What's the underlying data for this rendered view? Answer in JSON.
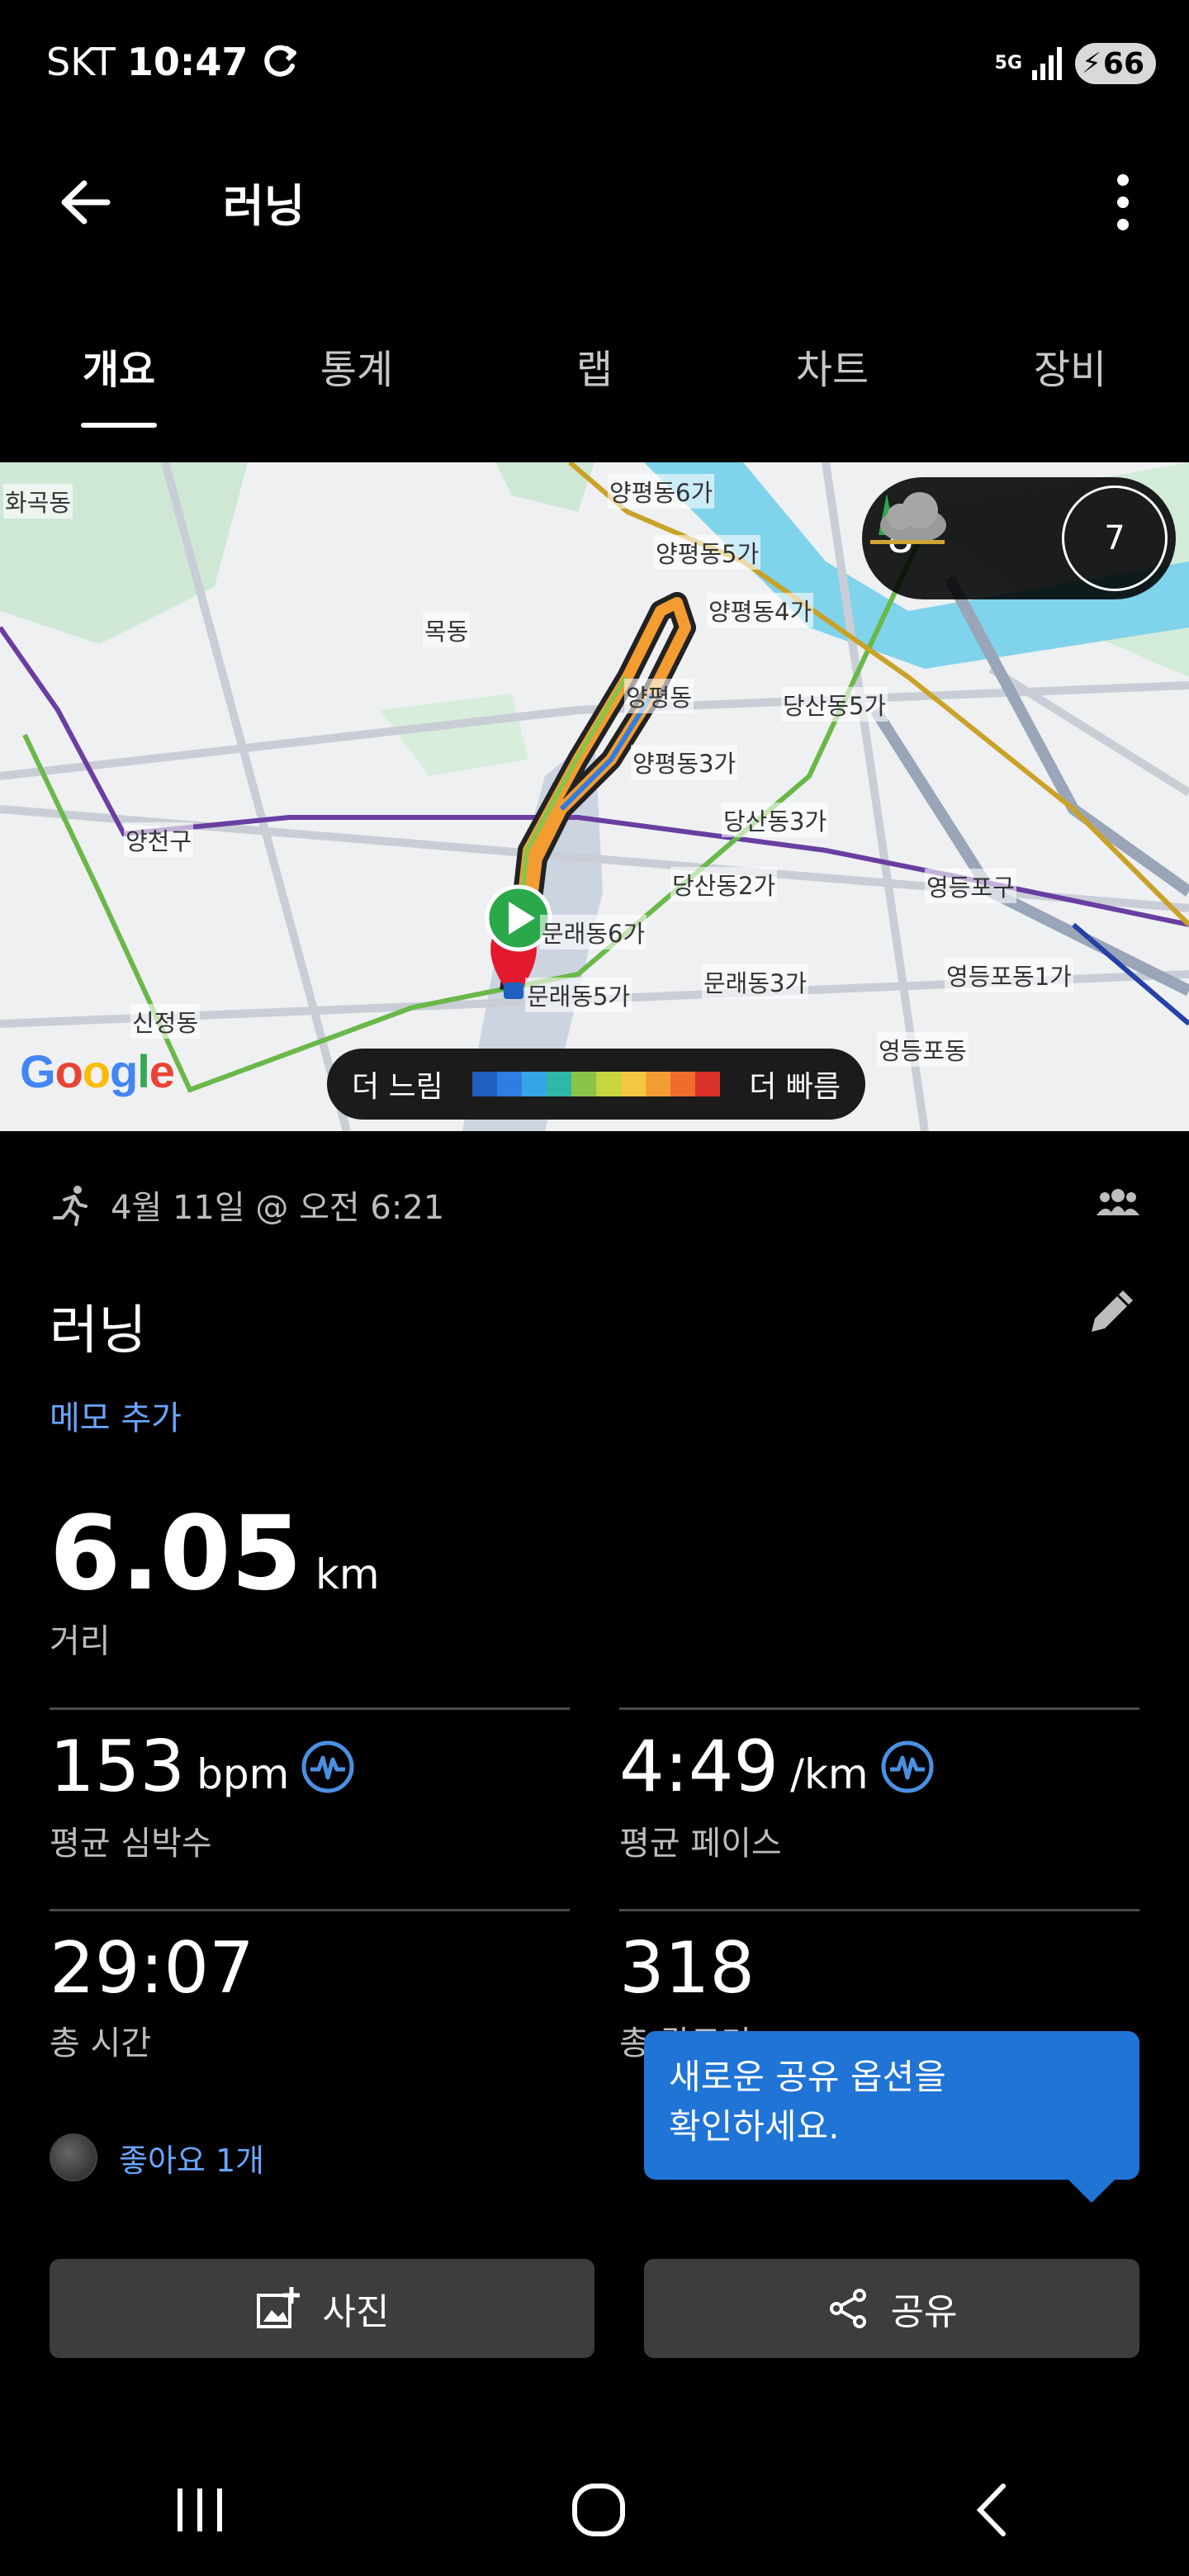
{
  "status_bar": {
    "carrier": "SKT",
    "time": "10:47",
    "network": "5G",
    "battery": "66"
  },
  "app_bar": {
    "title": "러닝"
  },
  "tabs": [
    {
      "label": "개요",
      "active": true
    },
    {
      "label": "통계",
      "active": false
    },
    {
      "label": "랩",
      "active": false
    },
    {
      "label": "차트",
      "active": false
    },
    {
      "label": "장비",
      "active": false
    }
  ],
  "map": {
    "labels": [
      "화곡동",
      "양평동6가",
      "양평동5가",
      "목동",
      "양평동4가",
      "양평동",
      "당산동5가",
      "양평동3가",
      "당산동3가",
      "양천구",
      "당산동2가",
      "영등포구",
      "문래동6가",
      "문래동5가",
      "문래동3가",
      "영등포동1가",
      "신정동",
      "영등포동"
    ],
    "google_logo": "Google",
    "weather": {
      "temperature": "8°",
      "icon": "cloudy-night-icon"
    },
    "compass_value": "7",
    "pace_legend": {
      "slow_label": "더 느림",
      "fast_label": "더 빠름",
      "colors": [
        "#1e5fbf",
        "#2f7de0",
        "#35a5e8",
        "#2fb7a8",
        "#8bc34a",
        "#c6d640",
        "#f2c744",
        "#f39c32",
        "#ef6c2c",
        "#d8312a"
      ]
    }
  },
  "activity": {
    "date_time": "4월 11일 @ 오전 6:21",
    "title": "러닝",
    "memo_link": "메모 추가"
  },
  "distance": {
    "value": "6.05",
    "unit": "km",
    "label": "거리"
  },
  "stats": {
    "heart_rate": {
      "value": "153",
      "unit": "bpm",
      "label": "평균 심박수"
    },
    "pace": {
      "value": "4:49",
      "unit": "/km",
      "label": "평균 페이스"
    },
    "total_time": {
      "value": "29:07",
      "label": "총 시간"
    },
    "calories": {
      "value": "318",
      "label": "총 칼로리"
    }
  },
  "likes": {
    "text": "좋아요 1개"
  },
  "tooltip": {
    "line1": "새로운 공유 옵션을",
    "line2": "확인하세요."
  },
  "buttons": {
    "photo": "사진",
    "share": "공유"
  }
}
